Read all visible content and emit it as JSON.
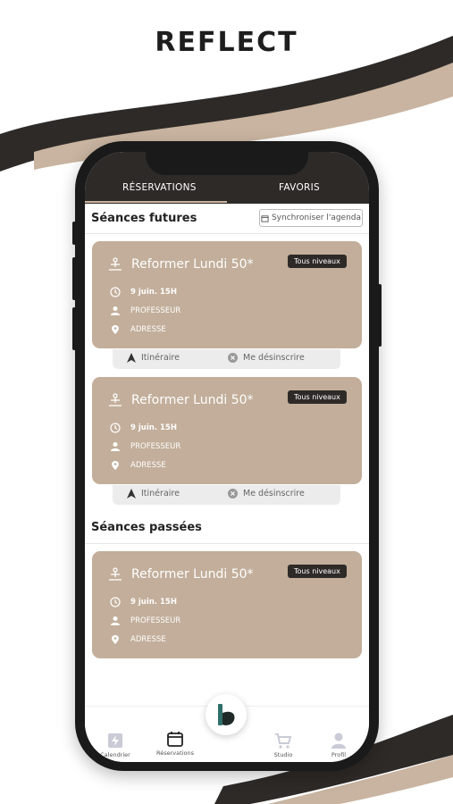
{
  "brand": {
    "logo_text": "REFLECT"
  },
  "tabs": [
    {
      "label": "RÉSERVATIONS",
      "active": true
    },
    {
      "label": "FAVORIS",
      "active": false
    }
  ],
  "sections": {
    "future_title": "Séances futures",
    "past_title": "Séances passées",
    "sync_label": "Synchroniser l'agenda"
  },
  "cards": [
    {
      "title": "Reformer Lundi 50*",
      "badge": "Tous niveaux",
      "date": "9 juin. 15H",
      "teacher": "PROFESSEUR",
      "address": "ADRESSE"
    },
    {
      "title": "Reformer Lundi 50*",
      "badge": "Tous niveaux",
      "date": "9 juin. 15H",
      "teacher": "PROFESSEUR",
      "address": "ADRESSE"
    },
    {
      "title": "Reformer Lundi 50*",
      "badge": "Tous niveaux",
      "date": "9 juin. 15H",
      "teacher": "PROFESSEUR",
      "address": "ADRESSE"
    }
  ],
  "actions": {
    "itinerary": "Itinéraire",
    "unsubscribe": "Me désinscrire"
  },
  "nav": [
    {
      "label": "Calendrier",
      "icon": "bolt-calendar-icon"
    },
    {
      "label": "Réservations",
      "icon": "calendar-icon"
    },
    {
      "label": "",
      "icon": "brand-b-icon"
    },
    {
      "label": "Studio",
      "icon": "cart-icon"
    },
    {
      "label": "Profil",
      "icon": "user-icon"
    }
  ],
  "colors": {
    "accent": "#c2ae9a",
    "dark": "#2e2a27",
    "nav_active": "#2f6f6a"
  }
}
